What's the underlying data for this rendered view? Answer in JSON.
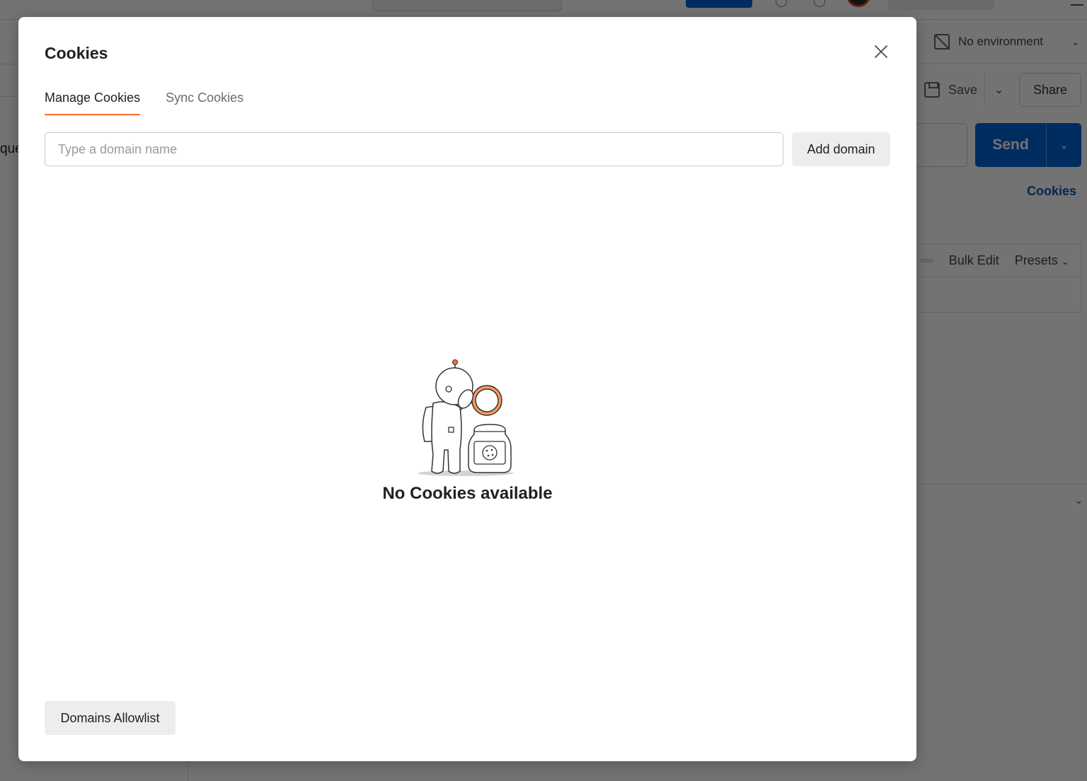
{
  "background": {
    "environment_label": "No environment",
    "save_label": "Save",
    "share_label": "Share",
    "send_label": "Send",
    "cookies_link": "Cookies",
    "bulk_edit_label": "Bulk Edit",
    "presets_label": "Presets",
    "left_partial_text": "que"
  },
  "modal": {
    "title": "Cookies",
    "tabs": [
      {
        "label": "Manage Cookies",
        "active": true
      },
      {
        "label": "Sync Cookies",
        "active": false
      }
    ],
    "domain_input": {
      "placeholder": "Type a domain name",
      "value": ""
    },
    "add_domain_label": "Add domain",
    "empty_state_text": "No Cookies available",
    "allowlist_button_label": "Domains Allowlist"
  },
  "colors": {
    "accent_orange": "#ff6c37",
    "send_blue": "#0265d2",
    "link_blue": "#0b57b5"
  },
  "icons": [
    "close-icon",
    "save-icon",
    "chevron-down-icon",
    "environment-off-icon",
    "empty-state-astronaut-illustration"
  ]
}
